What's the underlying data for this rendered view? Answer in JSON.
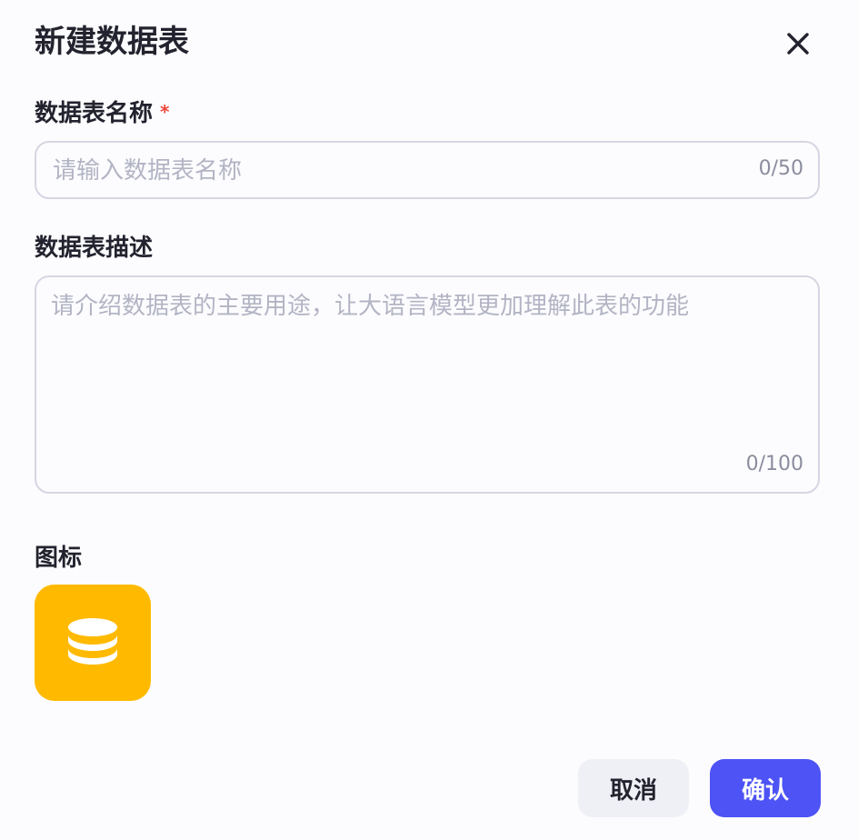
{
  "dialog": {
    "title": "新建数据表",
    "close_icon": "close-icon"
  },
  "name_field": {
    "label": "数据表名称",
    "required_mark": "*",
    "value": "",
    "placeholder": "请输入数据表名称",
    "counter": "0/50"
  },
  "desc_field": {
    "label": "数据表描述",
    "value": "",
    "placeholder": "请介绍数据表的主要用途，让大语言模型更加理解此表的功能",
    "counter": "0/100"
  },
  "icon_field": {
    "label": "图标",
    "icon": "database-icon",
    "color": "#ffba00"
  },
  "footer": {
    "cancel_label": "取消",
    "confirm_label": "确认",
    "confirm_color": "#4d53f5"
  }
}
